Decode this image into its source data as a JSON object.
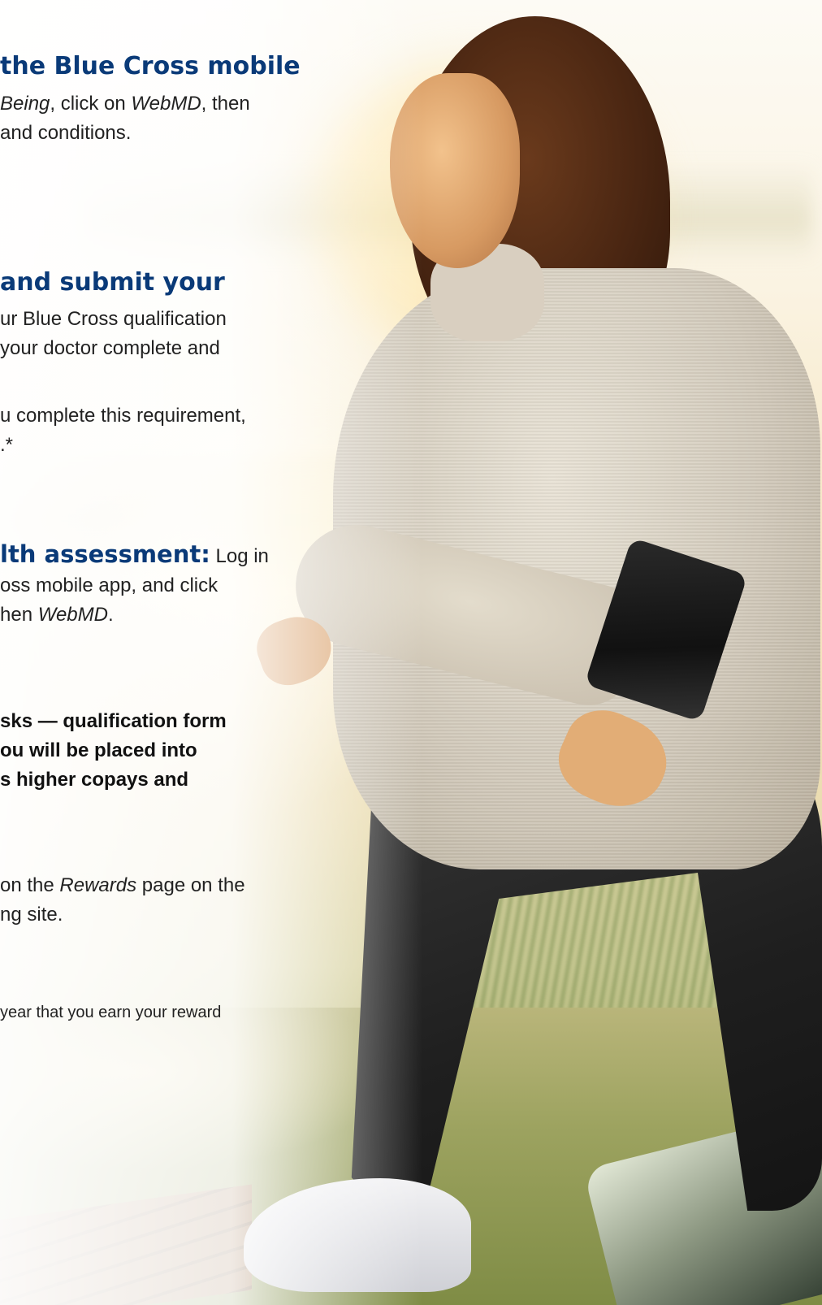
{
  "section1": {
    "heading": "the Blue Cross mobile",
    "line1_pre": "",
    "line1_italic_a": "Being",
    "line1_mid": ", click on ",
    "line1_italic_b": "WebMD",
    "line1_post": ", then",
    "line2": "and conditions."
  },
  "section2": {
    "heading": "and submit your",
    "line1": "ur Blue Cross qualification",
    "line2": " your doctor complete and",
    "line3": "u complete this requirement,",
    "line4": ".*"
  },
  "section3": {
    "heading_inline": "lth assessment:",
    "line1_post": " Log in",
    "line2": "oss mobile app, and click",
    "line3_pre": "hen ",
    "line3_italic": "WebMD",
    "line3_post": "."
  },
  "warning": {
    "line1": "sks — qualification form",
    "line2": "ou will be placed into",
    "line3": "s higher copays and"
  },
  "section4": {
    "line1_pre": "on the ",
    "line1_italic": "Rewards",
    "line1_post": " page on the",
    "line2": "ng site."
  },
  "footnote": {
    "text": "year that you earn your reward"
  },
  "colors": {
    "heading": "#0a3a78",
    "body_text": "#222222"
  }
}
